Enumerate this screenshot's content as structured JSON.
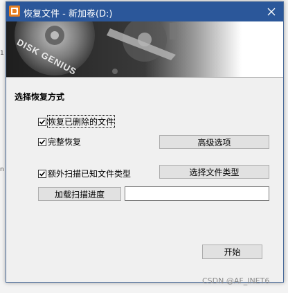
{
  "window": {
    "title": "恢复文件 - 新加卷(D:)"
  },
  "banner": {
    "brand_text": "DISK GENIUS"
  },
  "section": {
    "title": "选择恢复方式"
  },
  "options": [
    {
      "label": "恢复已删除的文件",
      "checked": true
    },
    {
      "label": "完整恢复",
      "checked": true
    },
    {
      "label": "额外扫描已知文件类型",
      "checked": true
    }
  ],
  "buttons": {
    "advanced": "高级选项",
    "select_types": "选择文件类型",
    "load_progress": "加载扫描进度",
    "start": "开始"
  },
  "progress_path": {
    "value": ""
  },
  "watermark": "CSDN @AF_INET6",
  "colors": {
    "titlebar": "#2b579a",
    "icon": "#e67e22"
  }
}
